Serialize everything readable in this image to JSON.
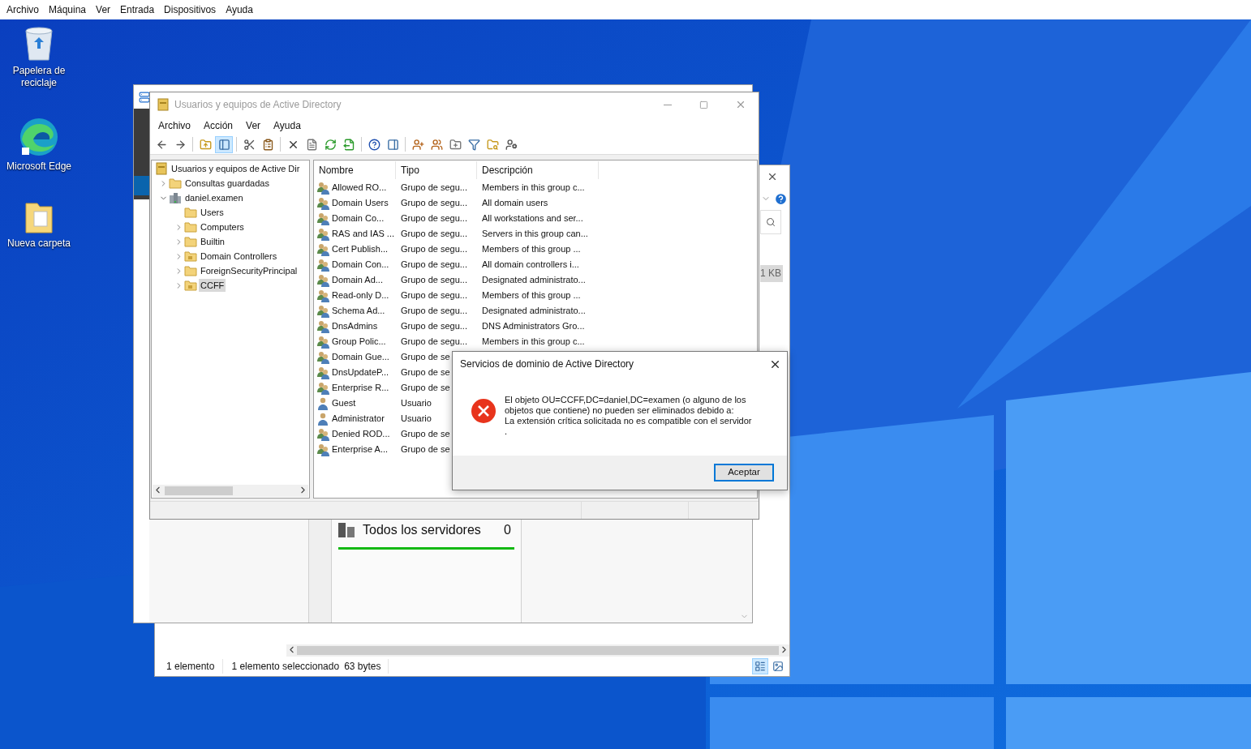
{
  "vm_menu": [
    "Archivo",
    "Máquina",
    "Ver",
    "Entrada",
    "Dispositivos",
    "Ayuda"
  ],
  "desktop_icons": [
    {
      "kind": "recycle",
      "label": "Papelera de reciclaje"
    },
    {
      "kind": "edge",
      "label": "Microsoft Edge"
    },
    {
      "kind": "folder",
      "label": "Nueva carpeta"
    }
  ],
  "explorer": {
    "size_cell": "1 KB",
    "status": [
      "1 elemento",
      "1 elemento seleccionado",
      "63 bytes"
    ],
    "views": [
      {
        "kind": "details",
        "selected": true
      },
      {
        "kind": "preview",
        "selected": false
      }
    ]
  },
  "server_manager": {
    "tile_title": "Todos los servidores",
    "tile_count": "0"
  },
  "aduc": {
    "title": "Usuarios y equipos de Active Directory",
    "menu": [
      "Archivo",
      "Acción",
      "Ver",
      "Ayuda"
    ],
    "toolbar": [
      {
        "kind": "back",
        "pressed": false
      },
      {
        "kind": "forward",
        "pressed": false
      },
      {
        "kind": "sep"
      },
      {
        "kind": "up",
        "pressed": false
      },
      {
        "kind": "tree",
        "pressed": true
      },
      {
        "kind": "sep"
      },
      {
        "kind": "cut",
        "pressed": false
      },
      {
        "kind": "paste",
        "pressed": false
      },
      {
        "kind": "sep"
      },
      {
        "kind": "delete",
        "pressed": false
      },
      {
        "kind": "properties",
        "pressed": false
      },
      {
        "kind": "refresh",
        "pressed": false
      },
      {
        "kind": "export",
        "pressed": false
      },
      {
        "kind": "sep"
      },
      {
        "kind": "help",
        "pressed": false
      },
      {
        "kind": "console",
        "pressed": false
      },
      {
        "kind": "sep"
      },
      {
        "kind": "new_user",
        "pressed": false
      },
      {
        "kind": "new_group",
        "pressed": false
      },
      {
        "kind": "new_ou",
        "pressed": false
      },
      {
        "kind": "filter",
        "pressed": false
      },
      {
        "kind": "find",
        "pressed": false
      },
      {
        "kind": "delegate",
        "pressed": false
      }
    ],
    "tree": {
      "label": "Usuarios y equipos de Active Dir",
      "kind": "snapin",
      "selected": false,
      "children": [
        {
          "label": "Consultas guardadas",
          "kind": "folder",
          "expanded": false,
          "selected": false
        },
        {
          "label": "daniel.examen",
          "kind": "domain",
          "expanded": true,
          "selected": false,
          "children": [
            {
              "label": "Users",
              "kind": "folder",
              "selected": false
            },
            {
              "label": "Computers",
              "kind": "folder",
              "expanded": false,
              "selected": false
            },
            {
              "label": "Builtin",
              "kind": "folder",
              "expanded": false,
              "selected": false
            },
            {
              "label": "Domain Controllers",
              "kind": "ou",
              "expanded": false,
              "selected": false
            },
            {
              "label": "ForeignSecurityPrincipal",
              "kind": "folder",
              "expanded": false,
              "selected": false
            },
            {
              "label": "CCFF",
              "kind": "ou",
              "expanded": false,
              "selected": true
            }
          ]
        }
      ]
    },
    "columns": [
      "Nombre",
      "Tipo",
      "Descripción"
    ],
    "rows": [
      {
        "kind": "group",
        "name": "Allowed RO...",
        "type": "Grupo de segu...",
        "description": "Members in this group c..."
      },
      {
        "kind": "group",
        "name": "Domain Users",
        "type": "Grupo de segu...",
        "description": "All domain users"
      },
      {
        "kind": "group",
        "name": "Domain Co...",
        "type": "Grupo de segu...",
        "description": "All workstations and ser..."
      },
      {
        "kind": "group",
        "name": "RAS and IAS ...",
        "type": "Grupo de segu...",
        "description": "Servers in this group can..."
      },
      {
        "kind": "group",
        "name": "Cert Publish...",
        "type": "Grupo de segu...",
        "description": "Members of this group ..."
      },
      {
        "kind": "group",
        "name": "Domain Con...",
        "type": "Grupo de segu...",
        "description": "All domain controllers i..."
      },
      {
        "kind": "group",
        "name": "Domain Ad...",
        "type": "Grupo de segu...",
        "description": "Designated administrato..."
      },
      {
        "kind": "group",
        "name": "Read-only D...",
        "type": "Grupo de segu...",
        "description": "Members of this group ..."
      },
      {
        "kind": "group",
        "name": "Schema Ad...",
        "type": "Grupo de segu...",
        "description": "Designated administrato..."
      },
      {
        "kind": "group",
        "name": "DnsAdmins",
        "type": "Grupo de segu...",
        "description": "DNS Administrators Gro..."
      },
      {
        "kind": "group",
        "name": "Group Polic...",
        "type": "Grupo de segu...",
        "description": "Members in this group c..."
      },
      {
        "kind": "group",
        "name": "Domain Gue...",
        "type": "Grupo de se"
      },
      {
        "kind": "group",
        "name": "DnsUpdateP...",
        "type": "Grupo de se"
      },
      {
        "kind": "group",
        "name": "Enterprise R...",
        "type": "Grupo de se"
      },
      {
        "kind": "user",
        "name": "Guest",
        "type": "Usuario"
      },
      {
        "kind": "user",
        "name": "Administrator",
        "type": "Usuario"
      },
      {
        "kind": "group",
        "name": "Denied ROD...",
        "type": "Grupo de se"
      },
      {
        "kind": "group",
        "name": "Enterprise A...",
        "type": "Grupo de se"
      }
    ]
  },
  "dialog": {
    "title": "Servicios de dominio de Active Directory",
    "message": "El objeto OU=CCFF,DC=daniel,DC=examen (o alguno de los\nobjetos que contiene) no pueden ser eliminados debido a:\nLa extensión crítica solicitada no es compatible con el servidor\n.",
    "button": "Aceptar"
  }
}
